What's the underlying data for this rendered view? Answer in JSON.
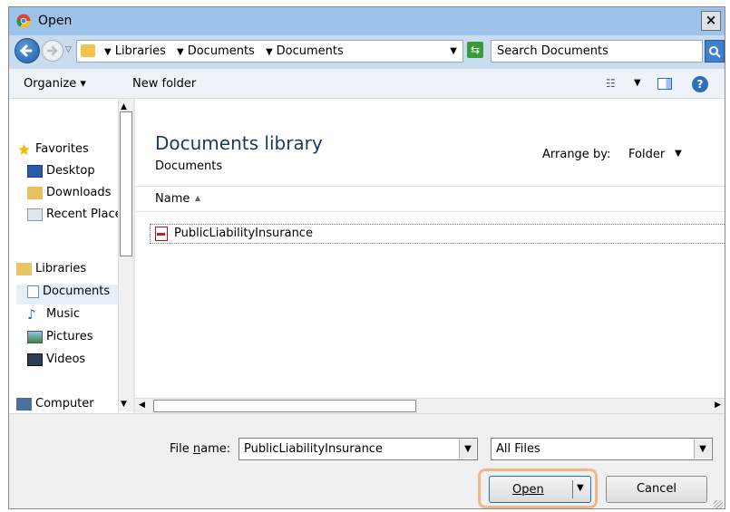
{
  "window": {
    "title": "Open",
    "close_label": "×"
  },
  "address_bar": {
    "crumbs": [
      "Libraries",
      "Documents",
      "Documents"
    ],
    "search_placeholder": "Search Documents"
  },
  "toolbar": {
    "organize": "Organize",
    "new_folder": "New folder"
  },
  "nav": {
    "items": [
      {
        "label": "Favorites",
        "icon": "star-icon"
      },
      {
        "label": "Desktop",
        "icon": "desktop-icon"
      },
      {
        "label": "Downloads",
        "icon": "downloads-icon"
      },
      {
        "label": "Recent Places",
        "icon": "recent-places-icon"
      },
      {
        "label": "Libraries",
        "icon": "libraries-icon"
      },
      {
        "label": "Documents",
        "icon": "document-icon",
        "selected": true
      },
      {
        "label": "Music",
        "icon": "music-icon"
      },
      {
        "label": "Pictures",
        "icon": "pictures-icon"
      },
      {
        "label": "Videos",
        "icon": "videos-icon"
      },
      {
        "label": "Computer",
        "icon": "computer-icon"
      }
    ]
  },
  "main": {
    "library_title": "Documents library",
    "library_subtitle": "Documents",
    "arrange_label": "Arrange by:",
    "arrange_value": "Folder",
    "column_header": "Name",
    "files": [
      {
        "name": "PublicLiabilityInsurance",
        "icon": "pdf-icon"
      }
    ]
  },
  "bottom": {
    "file_name_label_prefix": "File ",
    "file_name_label_accel": "n",
    "file_name_label_suffix": "ame:",
    "file_name_value": "PublicLiabilityInsurance",
    "file_type_value": "All Files",
    "open_label": "Open",
    "cancel_label": "Cancel"
  },
  "colors": {
    "titlebar": "#9ec3ea",
    "address_bar": "#c9dcef",
    "highlight": "#f0b88a",
    "accent": "#2a6cb8"
  }
}
